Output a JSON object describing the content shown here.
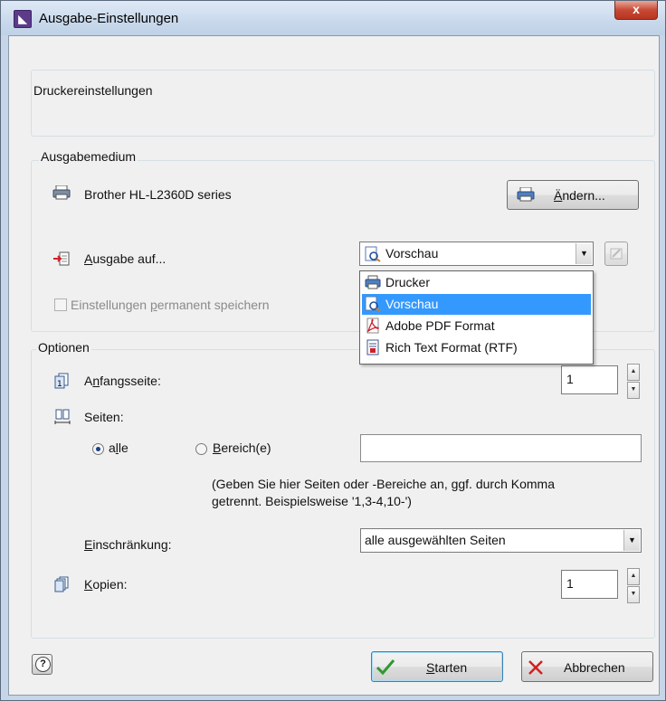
{
  "window": {
    "title": "Ausgabe-Einstellungen",
    "close_label": "x"
  },
  "printer_settings": {
    "label": "Druckereinstellungen"
  },
  "ausgabemedium": {
    "group_title": "Ausgabemedium",
    "printer_name": "Brother HL-L2360D series",
    "change_button": {
      "pre": "",
      "u": "Ä",
      "post": "ndern..."
    },
    "output_label": {
      "u": "A",
      "post": "usgabe auf..."
    },
    "output_selected": "Vorschau",
    "output_options": [
      "Drucker",
      "Vorschau",
      "Adobe PDF Format",
      "Rich Text Format (RTF)"
    ],
    "save_permanent": {
      "pre": "Einstellungen ",
      "u": "p",
      "post": "ermanent speichern"
    }
  },
  "optionen": {
    "group_title": "Optionen",
    "start_page": {
      "pre": "A",
      "u": "n",
      "post": "fangsseite:",
      "value": "1"
    },
    "pages_label": "Seiten:",
    "radio_all": {
      "pre": "a",
      "u": "l",
      "post": "le"
    },
    "radio_range": {
      "u": "B",
      "post": "ereich(e)"
    },
    "range_value": "",
    "hint_line1": "(Geben Sie hier Seiten oder -Bereiche an, ggf. durch Komma",
    "hint_line2": "getrennt. Beispielsweise '1,3-4,10-')",
    "restriction": {
      "u": "E",
      "post": "inschränkung:",
      "value": "alle ausgewählten Seiten"
    },
    "copies": {
      "u": "K",
      "post": "opien:",
      "value": "1"
    }
  },
  "footer": {
    "help_label": "?",
    "start_button": {
      "u": "S",
      "post": "tarten"
    },
    "cancel_button": "Abbrechen"
  },
  "colors": {
    "selection": "#3399ff",
    "dialog_bg": "#f0f0f0",
    "title_bg": "#c9d9ec",
    "close_red": "#c74a36"
  }
}
